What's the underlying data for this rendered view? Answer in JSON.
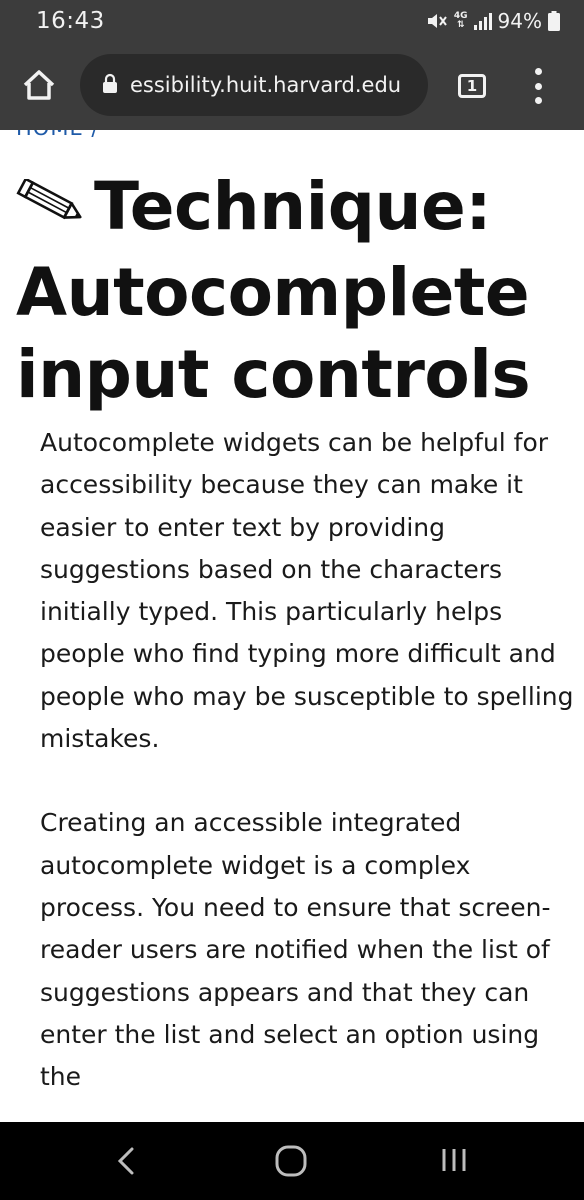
{
  "status_bar": {
    "time": "16:43",
    "network": "4G",
    "battery": "94%"
  },
  "browser": {
    "url": "essibility.huit.harvard.edu",
    "tab_count": "1"
  },
  "page": {
    "breadcrumb": "HOME /",
    "title": "Technique: Autocomplete input controls",
    "paragraphs": [
      "Autocomplete widgets can be helpful for accessibility because they can make it easier to enter text by providing suggestions based on the characters initially typed. This particularly helps people who find typing more difficult and people who may be susceptible to spelling mistakes.",
      "Creating an accessible integrated autocomplete widget is a complex process. You need to ensure that screen-reader users are notified when the list of suggestions appears and that they can enter the list and select an option using the"
    ]
  },
  "colors": {
    "chrome": "#3c3c3c",
    "breadcrumb_link": "#1e5aa8",
    "nav_bar": "#000000"
  }
}
